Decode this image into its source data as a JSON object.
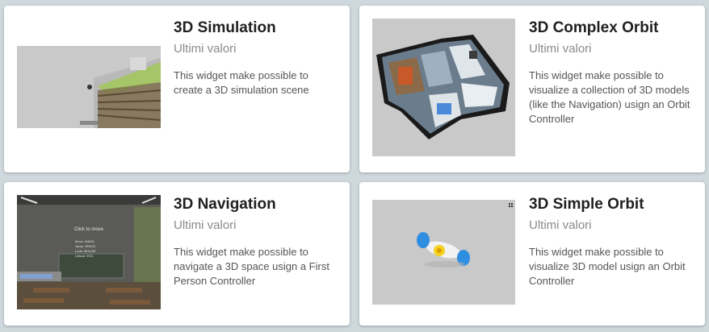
{
  "cards": [
    {
      "title": "3D Simulation",
      "subtitle": "Ultimi valori",
      "description": "This widget make possible to create a 3D simulation scene"
    },
    {
      "title": "3D Complex Orbit",
      "subtitle": "Ultimi valori",
      "description": "This widget make possible to visualize a collection of 3D models (like the Navigation) usign an Orbit Controller"
    },
    {
      "title": "3D Navigation",
      "subtitle": "Ultimi valori",
      "description": "This widget make possible to navigate a 3D space usign a First Person Controller",
      "preview_overlay": {
        "heading": "Click to move",
        "lines": [
          "Move: WASD",
          "Jump: SPACE",
          "Look: MOUSE",
          "Unlock: ESC"
        ]
      }
    },
    {
      "title": "3D Simple Orbit",
      "subtitle": "Ultimi valori",
      "description": "This widget make possible to visualize 3D model usign an Orbit Controller"
    }
  ],
  "icons": {
    "grid": "grid-icon",
    "fullscreen": "fullscreen-icon"
  }
}
